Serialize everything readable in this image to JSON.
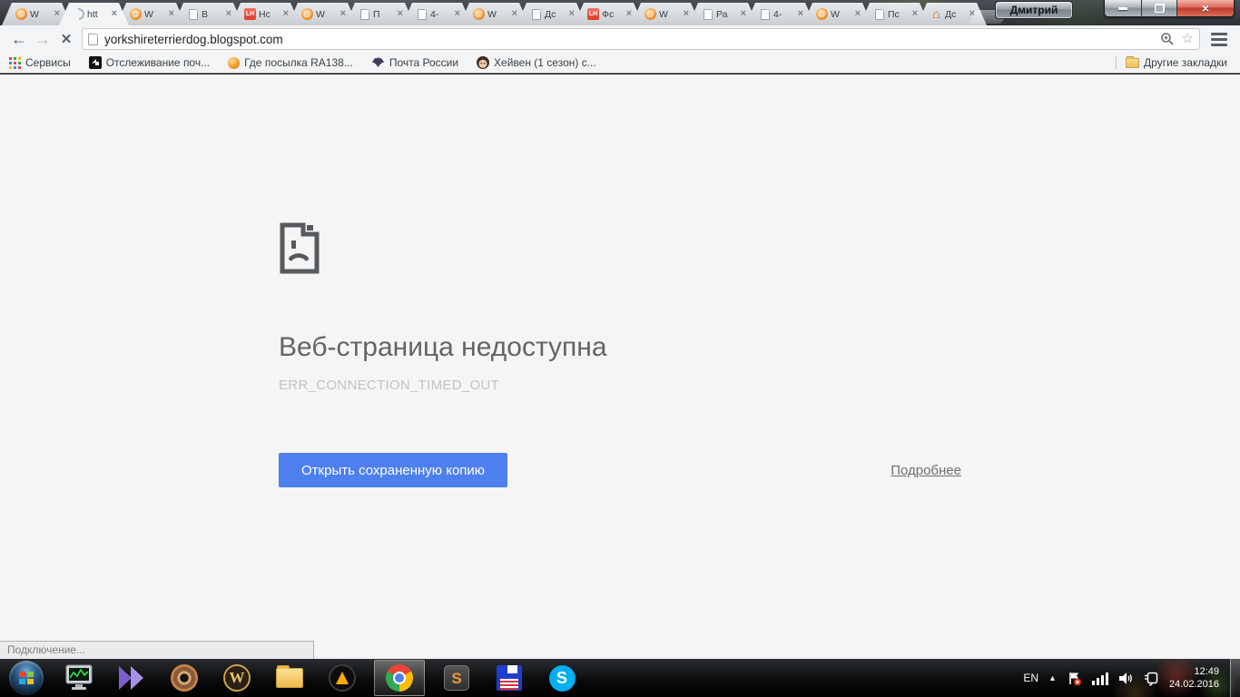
{
  "window": {
    "profile_name": "Дмитрий",
    "controls": {
      "minimize": "minimize-button",
      "restore": "restore-button",
      "close": "close-button"
    }
  },
  "tab_strip": {
    "close_glyph": "×",
    "tabs": [
      {
        "title": "W",
        "icon": "orange-at-favicon"
      },
      {
        "title": "htt",
        "icon": "loading-spinner",
        "active": true
      },
      {
        "title": "W",
        "icon": "orange-at-favicon"
      },
      {
        "title": "В",
        "icon": "document-favicon"
      },
      {
        "title": "Нс",
        "icon": "lh-red-favicon"
      },
      {
        "title": "W",
        "icon": "orange-at-favicon"
      },
      {
        "title": "П",
        "icon": "document-favicon"
      },
      {
        "title": "4-",
        "icon": "document-favicon"
      },
      {
        "title": "W",
        "icon": "orange-at-favicon"
      },
      {
        "title": "Дс",
        "icon": "document-favicon"
      },
      {
        "title": "Фс",
        "icon": "lh-red-favicon"
      },
      {
        "title": "W",
        "icon": "orange-at-favicon"
      },
      {
        "title": "Ра",
        "icon": "document-favicon"
      },
      {
        "title": "4-",
        "icon": "document-favicon"
      },
      {
        "title": "W",
        "icon": "orange-at-favicon"
      },
      {
        "title": "Пс",
        "icon": "document-favicon"
      },
      {
        "title": "Дс",
        "icon": "house-favicon"
      }
    ]
  },
  "toolbar": {
    "url": "yorkshireterrierdog.blogspot.com",
    "icons": [
      "back-arrow-icon",
      "forward-arrow-icon",
      "stop-icon",
      "page-icon",
      "zoom-magnifier-icon",
      "bookmark-star-icon",
      "menu-hamburger-icon"
    ],
    "back_glyph": "←",
    "forward_glyph": "→",
    "stop_glyph": "✕",
    "star_glyph": "☆"
  },
  "bookmarks_bar": {
    "items": [
      {
        "label": "Сервисы",
        "icon": "apps-grid-icon"
      },
      {
        "label": "Отслеживание поч...",
        "icon": "tracking-black-icon"
      },
      {
        "label": "Где посылка RA138...",
        "icon": "orange-ball-icon"
      },
      {
        "label": "Почта России",
        "icon": "russian-post-eagle-icon"
      },
      {
        "label": "Хейвен (1 сезон) с...",
        "icon": "face-icon"
      }
    ],
    "other_bookmarks_label": "Другие закладки"
  },
  "error_page": {
    "icon": "sad-page-icon",
    "title": "Веб-страница недоступна",
    "error_code": "ERR_CONNECTION_TIMED_OUT",
    "primary_button": "Открыть сохраненную копию",
    "details_link": "Подробнее",
    "button_color": "#4d80ee"
  },
  "status_bubble": {
    "text": "Подключение..."
  },
  "taskbar": {
    "items": [
      "windows-start",
      "system-monitor",
      "kmplayer",
      "disc-emulator",
      "world-of-warcraft",
      "file-explorer",
      "aimp-player",
      "google-chrome",
      "sublime-text",
      "floppy-save",
      "skype"
    ],
    "active_item": "google-chrome",
    "wow_letter": "W",
    "sublime_letter": "S",
    "skype_letter": "S",
    "tray": {
      "language": "EN",
      "hidden_icons_glyph": "▲",
      "icons": [
        "action-center-flag-icon",
        "network-signal-icon",
        "volume-icon",
        "connection-plug-icon"
      ],
      "time": "12:49",
      "date": "24.02.2016"
    }
  },
  "colors": {
    "accent_blue": "#4d80ee",
    "close_button_red": "#c03a2b",
    "error_title_gray": "#646464",
    "error_code_gray": "#c3c3c3",
    "content_background": "#f5f5f5"
  }
}
